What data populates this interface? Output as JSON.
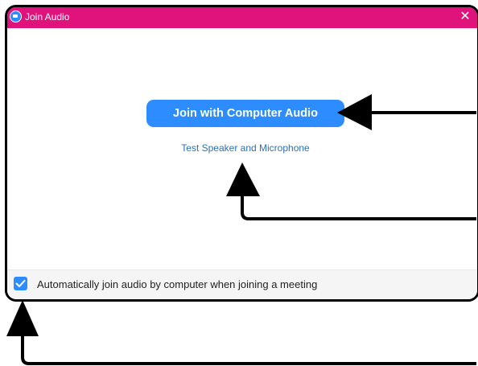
{
  "window": {
    "title": "Join Audio",
    "close_glyph": "✕",
    "titlebar_color": "#e0137c"
  },
  "main": {
    "join_button_label": "Join with Computer Audio",
    "test_link_label": "Test Speaker and Microphone",
    "accent_color": "#2d8cff"
  },
  "footer": {
    "auto_join_label": "Automatically join audio by computer when joining a meeting",
    "auto_join_checked": true
  },
  "annotations": {
    "arrow_icon": "black-arrow-icon",
    "count": 3
  }
}
